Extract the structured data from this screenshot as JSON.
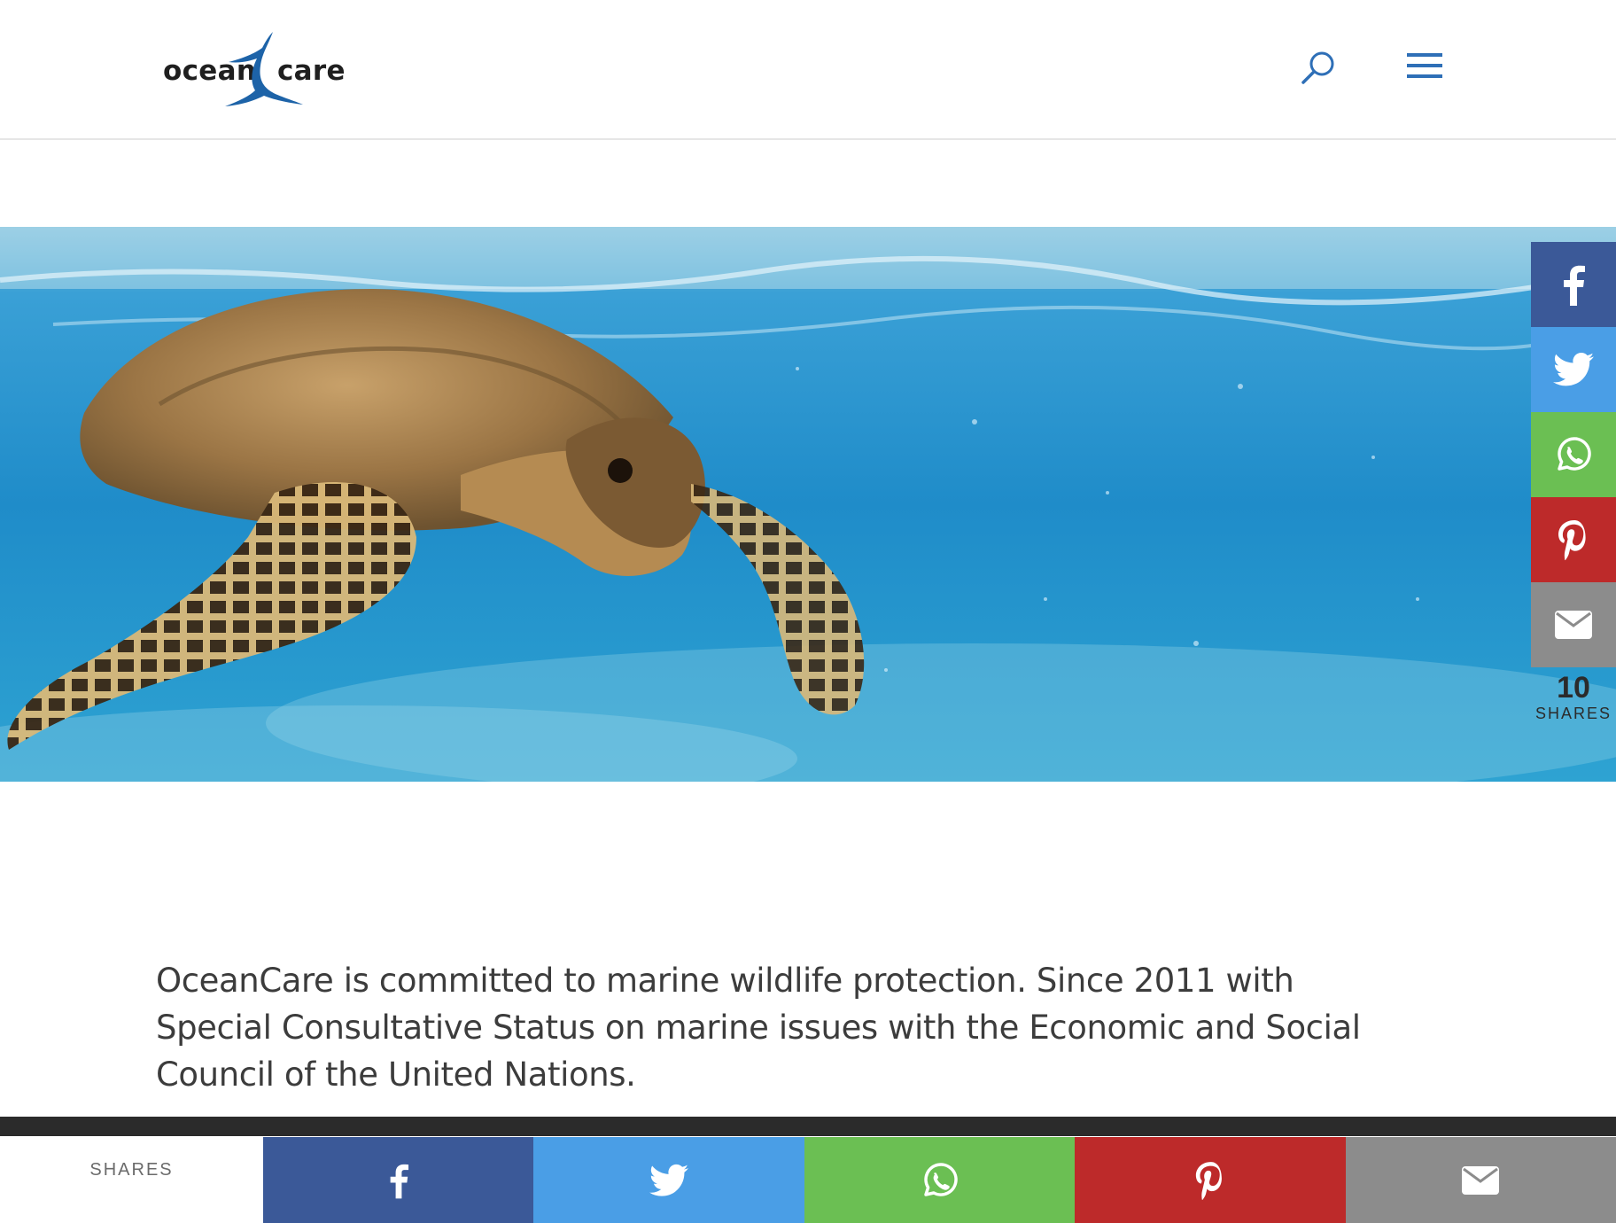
{
  "brand": {
    "logo_left": "ocean",
    "logo_right": "care",
    "mark_color": "#1d63a8"
  },
  "header": {
    "search_icon": "search-icon",
    "menu_icon": "hamburger-menu-icon",
    "icon_color": "#2e6fb7"
  },
  "hero": {
    "image": "sea turtle swimming underwater near the surface"
  },
  "side_share": {
    "buttons": [
      {
        "network": "facebook",
        "icon": "facebook-icon",
        "color": "#3b5998"
      },
      {
        "network": "twitter",
        "icon": "twitter-icon",
        "color": "#4a9ee6"
      },
      {
        "network": "whatsapp",
        "icon": "whatsapp-icon",
        "color": "#6bbf53"
      },
      {
        "network": "pinterest",
        "icon": "pinterest-icon",
        "color": "#bd2a2a"
      },
      {
        "network": "email",
        "icon": "email-icon",
        "color": "#8c8c8c"
      }
    ],
    "count": "10",
    "count_label": "SHARES"
  },
  "intro": {
    "text": "OceanCare is committed to marine wildlife protection. Since 2011 with Special Consultative Status on marine issues with the Economic and Social Council of the United Nations."
  },
  "bottom_share": {
    "label": "SHARES"
  }
}
